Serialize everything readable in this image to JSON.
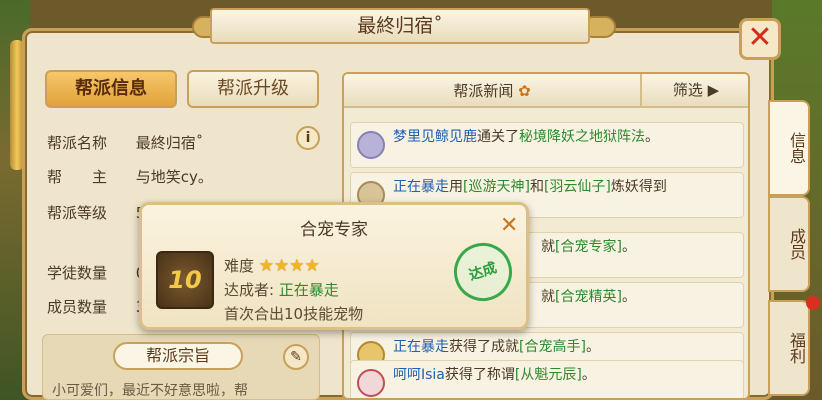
{
  "window": {
    "title": "最終归宿˚",
    "close_icon": "close-icon"
  },
  "left_tabs": [
    {
      "label": "帮派信息",
      "active": true
    },
    {
      "label": "帮派升级",
      "active": false
    }
  ],
  "guild_info": {
    "name_label": "帮派名称",
    "name_value": "最終归宿˚",
    "leader_label": "帮　　主",
    "leader_value": "与地笑cy。",
    "level_label": "帮派等级",
    "level_value": "5",
    "apprentice_label": "学徒数量",
    "apprentice_value": "0/",
    "member_label": "成员数量",
    "member_value": "3"
  },
  "motto": {
    "title": "帮派宗旨",
    "text": "小可爱们，最近不好意思啦，帮"
  },
  "news": {
    "header": "帮派新闻",
    "filter": "筛选",
    "items": [
      {
        "name": "梦里见鲸见鹿",
        "text1": "通关了",
        "highlight": "秘境降妖之地狱阵法",
        "text2": "。"
      },
      {
        "name": "正在暴走",
        "text1": "用",
        "highlight": "[巡游天神]",
        "text2": "和",
        "highlight2": "[羽云仙子]",
        "text3": "炼妖得到"
      },
      {
        "name": "",
        "text1": "就",
        "highlight": "[合宠专家]",
        "text2": "。"
      },
      {
        "name": "",
        "text1": "就",
        "highlight": "[合宠精英]",
        "text2": "。"
      },
      {
        "name": "正在暴走",
        "text1": "获得了成就",
        "highlight": "[合宠高手]",
        "text2": "。"
      },
      {
        "name": "呵呵Isia",
        "text1": "获得了称谓",
        "highlight": "[从魁元辰]",
        "text2": "。"
      }
    ]
  },
  "side_tabs": [
    "信息",
    "成员",
    "福利"
  ],
  "popup": {
    "title": "合宠专家",
    "badge": "10",
    "difficulty_label": "难度",
    "stars": 4,
    "achiever_label": "达成者:",
    "achiever_name": "正在暴走",
    "description": "首次合出10技能宠物",
    "stamp": "达成"
  }
}
